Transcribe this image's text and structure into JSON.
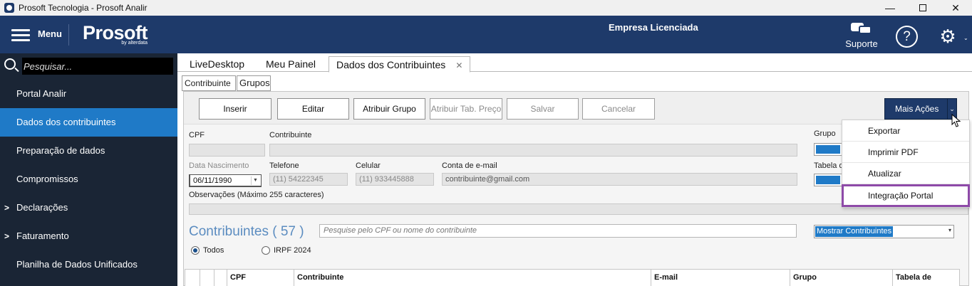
{
  "window": {
    "title": "Prosoft Tecnologia - Prosoft Analir",
    "minimize": "—",
    "close": "✕"
  },
  "header": {
    "menu_label": "Menu",
    "logo_text": "Prosoft",
    "logo_sub": "by alterdata",
    "company": "Empresa Licenciada",
    "support_label": "Suporte",
    "help_glyph": "?",
    "gear_glyph": "⚙",
    "gear_caret": "⌄"
  },
  "sidebar": {
    "search_placeholder": "Pesquisar...",
    "items": [
      {
        "label": "Portal Analir",
        "expandable": false,
        "active": false
      },
      {
        "label": "Dados dos contribuintes",
        "expandable": false,
        "active": true
      },
      {
        "label": "Preparação de dados",
        "expandable": false,
        "active": false
      },
      {
        "label": "Compromissos",
        "expandable": false,
        "active": false
      },
      {
        "label": "Declarações",
        "expandable": true,
        "active": false
      },
      {
        "label": "Faturamento",
        "expandable": true,
        "active": false
      },
      {
        "label": "Planilha de Dados Unificados",
        "expandable": false,
        "active": false
      }
    ],
    "arrow": ">"
  },
  "tabs": [
    {
      "label": "LiveDesktop"
    },
    {
      "label": "Meu Painel"
    },
    {
      "label": "Dados dos Contribuintes",
      "close": "✕"
    }
  ],
  "subtabs": [
    {
      "label": "Contribuinte"
    },
    {
      "label": "Grupos"
    }
  ],
  "toolbar": {
    "buttons": [
      {
        "label": "Inserir",
        "enabled": true
      },
      {
        "label": "Editar",
        "enabled": true
      },
      {
        "label": "Atribuir Grupo",
        "enabled": true
      },
      {
        "label": "Atribuir Tab. Preço",
        "enabled": false
      },
      {
        "label": "Salvar",
        "enabled": false
      },
      {
        "label": "Cancelar",
        "enabled": false
      }
    ],
    "more_actions": "Mais Ações",
    "more_caret": "⌄"
  },
  "form": {
    "cpf_label": "CPF",
    "contribuinte_label": "Contribuinte",
    "grupo_label": "Grupo",
    "nascimento_label": "Data Nascimento",
    "nascimento_value": "06/11/1990",
    "telefone_label": "Telefone",
    "telefone_value": "(11) 54222345",
    "celular_label": "Celular",
    "celular_value": "(11) 933445888",
    "email_label": "Conta de e-mail",
    "email_value": "contribuinte@gmail.com",
    "tabela_label": "Tabela d",
    "obs_label": "Observações (Máximo 255 caracteres)"
  },
  "list": {
    "title": "Contribuintes ( 57 )",
    "filter_placeholder": "Pesquise pelo CPF ou nome do contribuinte",
    "show_select": "Mostrar Contribuintes",
    "select_caret": "▾",
    "radio_all": "Todos",
    "radio_irpf": "IRPF 2024",
    "columns": [
      "CPF",
      "Contribuinte",
      "E-mail",
      "Grupo",
      "Tabela de"
    ]
  },
  "dropdown": {
    "items": [
      {
        "label": "Exportar"
      },
      {
        "label": "Imprimir PDF"
      },
      {
        "label": "Atualizar"
      },
      {
        "label": "Integração Portal"
      }
    ]
  }
}
